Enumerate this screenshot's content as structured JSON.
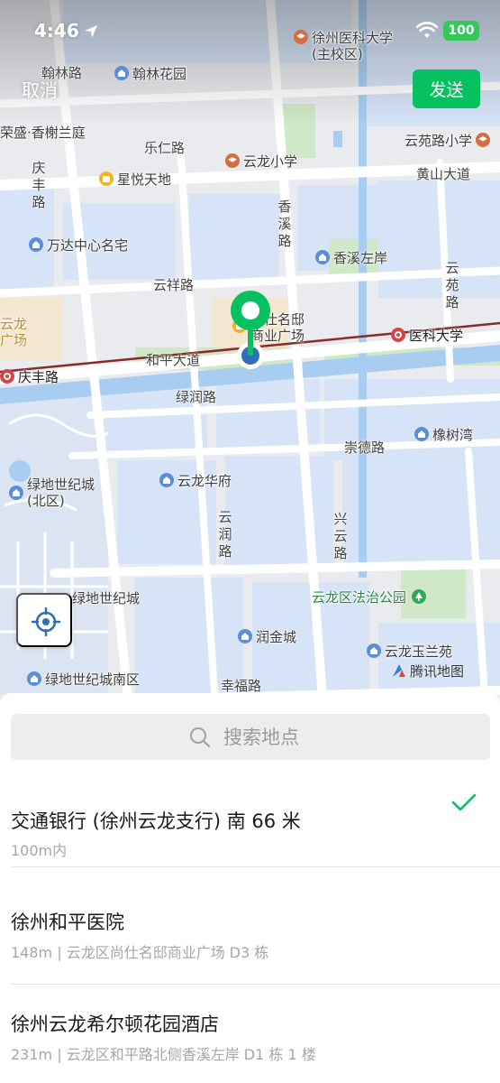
{
  "status_bar": {
    "time": "4:46",
    "battery": "100"
  },
  "header": {
    "cancel_label": "取消",
    "send_label": "发送"
  },
  "map": {
    "watermark": "腾讯地图",
    "pois": [
      {
        "id": "xzmu",
        "text": "徐州医科大学\n(主校区)",
        "icon": "school-icon"
      },
      {
        "id": "hanlin-garden",
        "text": "翰林花园",
        "icon": "house-icon"
      },
      {
        "id": "yunlong-primary",
        "text": "云龙小学",
        "icon": "school-icon"
      },
      {
        "id": "yunyuan-primary",
        "text": "云苑路小学",
        "icon": "school-icon"
      },
      {
        "id": "xingyue",
        "text": "星悦天地",
        "icon": "shop-icon"
      },
      {
        "id": "wanda",
        "text": "万达中心名宅",
        "icon": "house-icon"
      },
      {
        "id": "xiangxi-zuoan",
        "text": "香溪左岸",
        "icon": "house-icon"
      },
      {
        "id": "shangshi",
        "text": "尚仕名邸\n商业广场",
        "icon": "shop-icon"
      },
      {
        "id": "yunlong-plaza",
        "text": "云龙\n广场",
        "icon": "shop-icon"
      },
      {
        "id": "metro-xzmu",
        "text": "医科大学",
        "icon": "metro-icon"
      },
      {
        "id": "metro-qingfeng",
        "text": "庆丰路",
        "icon": "metro-icon"
      },
      {
        "id": "xiangshuwan",
        "text": "橡树湾",
        "icon": "house-icon"
      },
      {
        "id": "greenland-north",
        "text": "绿地世纪城\n(北区)",
        "icon": "house-icon"
      },
      {
        "id": "yunlong-huafu",
        "text": "云龙华府",
        "icon": "house-icon"
      },
      {
        "id": "greenland",
        "text": "绿地世纪城",
        "icon": "house-icon"
      },
      {
        "id": "law-park",
        "text": "云龙区法治公园",
        "icon": "park-icon"
      },
      {
        "id": "runjin",
        "text": "润金城",
        "icon": "house-icon"
      },
      {
        "id": "yulanyuan",
        "text": "云龙玉兰苑",
        "icon": "house-icon"
      },
      {
        "id": "greenland-south",
        "text": "绿地世纪城南区",
        "icon": "house-icon"
      },
      {
        "id": "rongsheng",
        "text": "荣盛·香榭兰庭",
        "icon": ""
      }
    ],
    "roads": {
      "hanlin": "翰林路",
      "leren": "乐仁路",
      "huangshan": "黄山大道",
      "qingfeng": "庆丰路",
      "xiangxi": "香溪路",
      "yunxiang": "云祥路",
      "yunyuan": "云苑路",
      "heping": "和平大道",
      "lvrun": "绿润路",
      "chongde": "崇德路",
      "yunrun": "云润路",
      "xingyun": "兴云路",
      "xingfu": "幸福路"
    }
  },
  "search": {
    "placeholder": "搜索地点"
  },
  "results": [
    {
      "name": "交通银行 (徐州云龙支行) 南 66 米",
      "desc": "100m内",
      "selected": true
    },
    {
      "name": "徐州和平医院",
      "desc": "148m | 云龙区尚仕名邸商业广场 D3 栋",
      "selected": false
    },
    {
      "name": "徐州云龙希尔顿花园酒店",
      "desc": "231m | 云龙区和平路北侧香溪左岸 D1 栋 1 楼",
      "selected": false
    }
  ],
  "colors": {
    "accent": "#07c160",
    "pin_green": "#07c160",
    "pin_blue": "#2f6fb5"
  }
}
